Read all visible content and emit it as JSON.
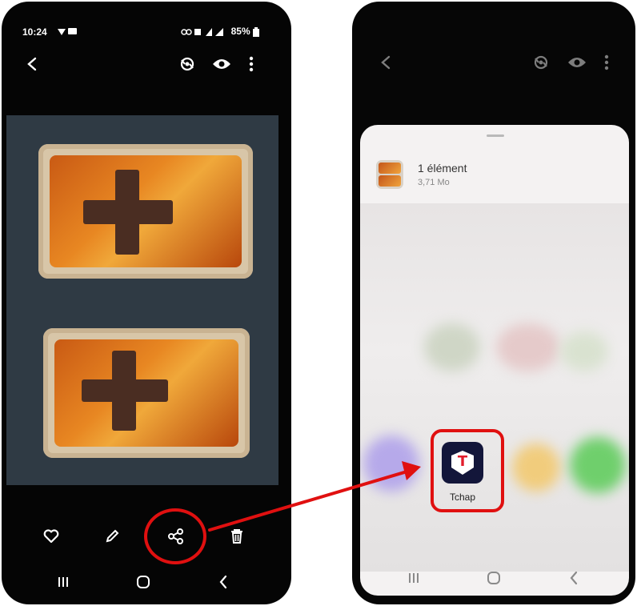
{
  "left_screen": {
    "status": {
      "time": "10:24",
      "battery": "85%"
    },
    "top_bar": {
      "back_icon": "back-arrow-icon",
      "icons": [
        "remaster-icon",
        "eye-icon",
        "more-vert-icon"
      ]
    },
    "bottom_actions": [
      "heart-icon",
      "pencil-icon",
      "share-icon",
      "trash-icon"
    ]
  },
  "right_screen": {
    "share_sheet": {
      "file_title": "1 élément",
      "file_size": "3,71 Mo",
      "highlighted_app": {
        "label": "Tchap",
        "icon_letter": "T",
        "tile_color": "#13163a",
        "letter_color": "#e21d2c"
      }
    }
  },
  "annotations": {
    "color": "#e01010"
  }
}
